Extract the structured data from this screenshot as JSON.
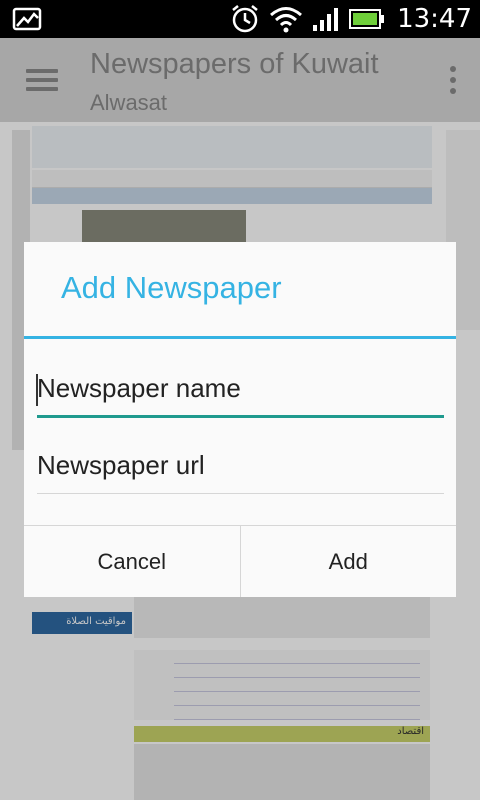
{
  "status_bar": {
    "time": "13:47",
    "icons": [
      "image-icon",
      "alarm-icon",
      "wifi-icon",
      "signal-icon",
      "battery-icon"
    ]
  },
  "action_bar": {
    "title": "Newspapers of Kuwait",
    "subtitle": "Alwasat",
    "icons": [
      "menu-icon",
      "overflow-icon"
    ]
  },
  "background_page": {
    "prayer_label": "مواقيت الصلاة",
    "section_label": "اقتصاد"
  },
  "dialog": {
    "title": "Add Newspaper",
    "name_placeholder": "Newspaper name",
    "url_placeholder": "Newspaper url",
    "cancel_label": "Cancel",
    "add_label": "Add"
  },
  "colors": {
    "accent": "#35b3e3",
    "field_focus": "#1f9a8e",
    "action_bar": "#8b0000"
  }
}
